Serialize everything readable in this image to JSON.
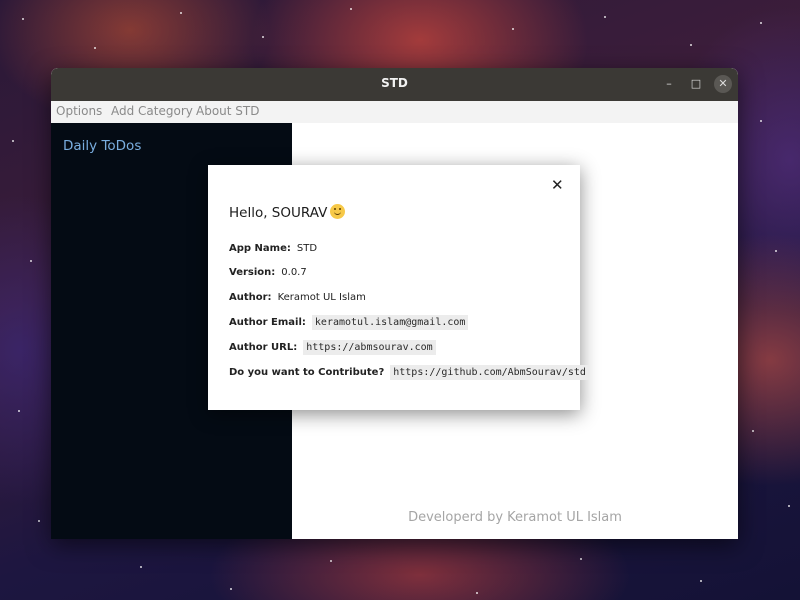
{
  "window": {
    "title": "STD",
    "minimize_glyph": "–",
    "maximize_glyph": "□",
    "close_glyph": "✕"
  },
  "menu": {
    "items": [
      {
        "label": "Options"
      },
      {
        "label": "Add Category"
      },
      {
        "label": "About STD"
      }
    ]
  },
  "sidebar": {
    "title": "Daily ToDos"
  },
  "main": {
    "footer_credit": "Developerd by  Keramot UL Islam"
  },
  "about_dialog": {
    "close_glyph": "✕",
    "greeting": "Hello, SOURAV",
    "emoji_icon": "smile-icon",
    "rows": [
      {
        "label": "App Name:",
        "value": "STD"
      },
      {
        "label": "Version:",
        "value": "0.0.7"
      },
      {
        "label": "Author:",
        "value": "Keramot UL Islam"
      },
      {
        "label": "Author Email:",
        "value": "keramotul.islam@gmail.com"
      },
      {
        "label": "Author URL:",
        "value": "https://abmsourav.com"
      },
      {
        "label": "Do you want to Contribute?",
        "value": "https://github.com/AbmSourav/std"
      }
    ]
  },
  "colors": {
    "titlebar": "#3b3935",
    "menubar": "#f3f3f3",
    "sidebar_bg": "#040b14",
    "sidebar_title": "#7aaee0",
    "footer_text": "#a5a5a5",
    "code_bg": "#ececec"
  }
}
